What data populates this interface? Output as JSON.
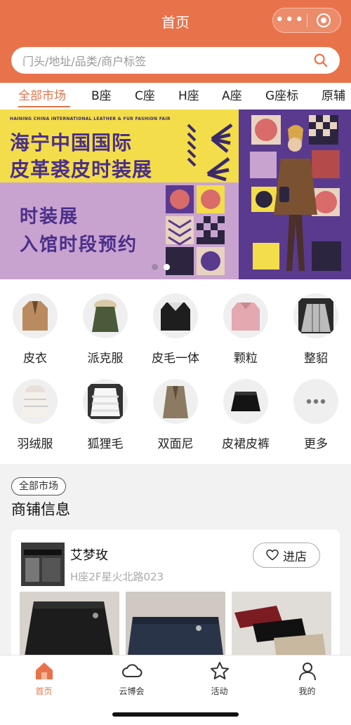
{
  "header": {
    "title": "首页",
    "capsule_more": "•••",
    "brand_color": "#e8734a"
  },
  "search": {
    "placeholder": "门头/地址/品类/商户标签",
    "icon": "search-icon"
  },
  "tabs": [
    {
      "label": "全部市场",
      "active": true
    },
    {
      "label": "B座"
    },
    {
      "label": "C座"
    },
    {
      "label": "H座"
    },
    {
      "label": "A座"
    },
    {
      "label": "G座标"
    },
    {
      "label": "原辅"
    }
  ],
  "banner": {
    "english": "HAINING CHINA INTERNATIONAL LEATHER & FUR FASHION FAIR",
    "title_line1": "海宁中国国际",
    "title_line2": "皮革裘皮时装展",
    "subtitle_line1": "时装展",
    "subtitle_line2": "入馆时段预约",
    "slides": 2,
    "active_slide": 2
  },
  "categories": [
    {
      "label": "皮衣"
    },
    {
      "label": "派克服"
    },
    {
      "label": "皮毛一体"
    },
    {
      "label": "颗粒"
    },
    {
      "label": "整貂"
    },
    {
      "label": "羽绒服"
    },
    {
      "label": "狐狸毛"
    },
    {
      "label": "双面尼"
    },
    {
      "label": "皮裙皮裤"
    },
    {
      "label": "更多"
    }
  ],
  "shops_section": {
    "chip": "全部市场",
    "title": "商铺信息",
    "shop": {
      "name": "艾梦玫",
      "address": "H座2F星火北路023",
      "enter_label": "进店"
    }
  },
  "bottom_nav": [
    {
      "label": "首页",
      "icon": "home-icon",
      "active": true
    },
    {
      "label": "云博会",
      "icon": "cloud-icon"
    },
    {
      "label": "活动",
      "icon": "star-icon"
    },
    {
      "label": "我的",
      "icon": "user-icon"
    }
  ]
}
